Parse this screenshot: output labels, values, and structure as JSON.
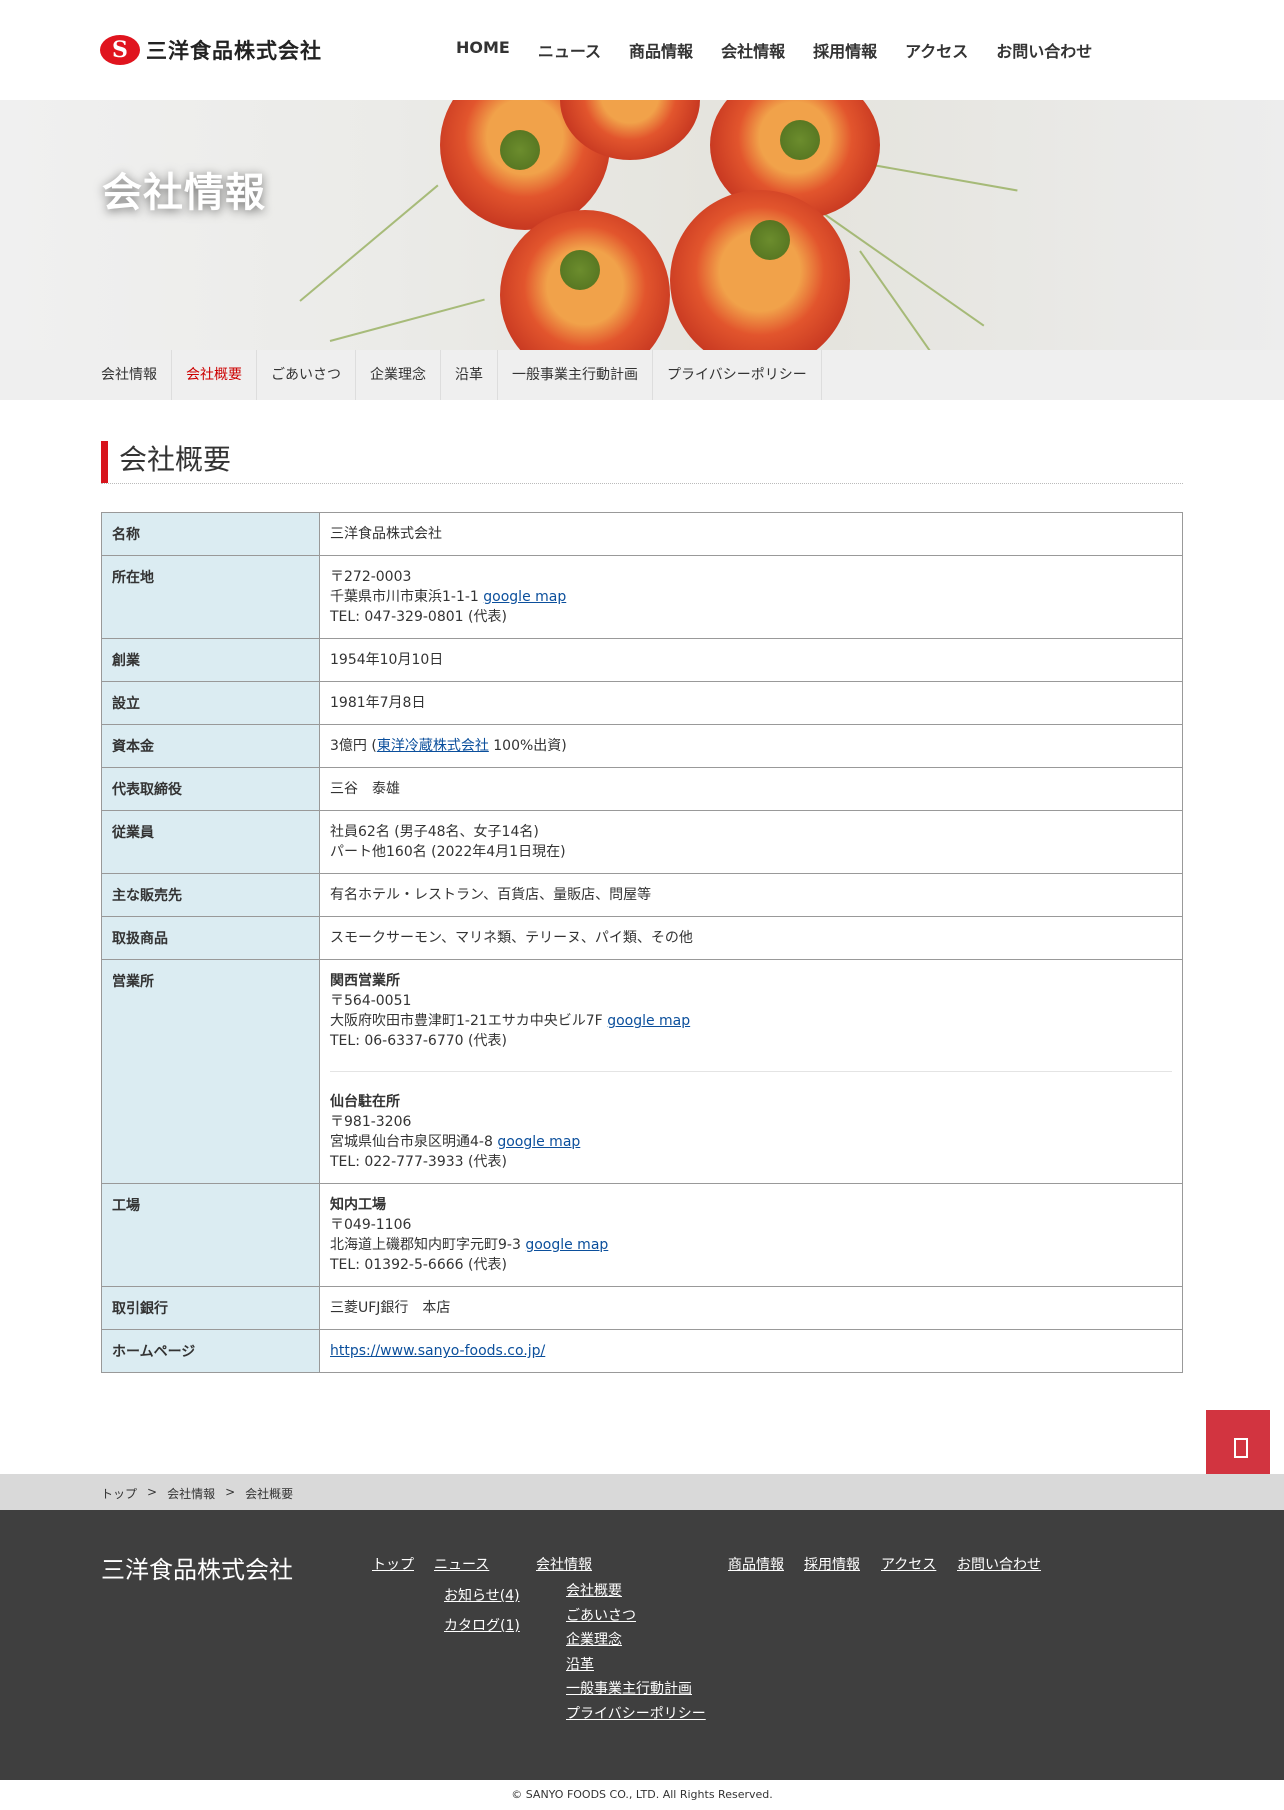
{
  "header": {
    "logo_text": "三洋食品株式会社",
    "nav": [
      "HOME",
      "ニュース",
      "商品情報",
      "会社情報",
      "採用情報",
      "アクセス",
      "お問い合わせ"
    ]
  },
  "hero": {
    "title": "会社情報"
  },
  "subnav": {
    "items": [
      "会社情報",
      "会社概要",
      "ごあいさつ",
      "企業理念",
      "沿革",
      "一般事業主行動計画",
      "プライバシーポリシー"
    ],
    "active_index": 1
  },
  "section": {
    "title": "会社概要"
  },
  "table": {
    "name": {
      "label": "名称",
      "value": "三洋食品株式会社"
    },
    "address": {
      "label": "所在地",
      "postal": "〒272-0003",
      "addr": "千葉県市川市東浜1-1-1 ",
      "map": "google map",
      "tel": "TEL: 047-329-0801 (代表)"
    },
    "founded": {
      "label": "創業",
      "value": "1954年10月10日"
    },
    "established": {
      "label": "設立",
      "value": "1981年7月8日"
    },
    "capital": {
      "label": "資本金",
      "prefix": "3億円 (",
      "link": "東洋冷蔵株式会社",
      "suffix": " 100%出資)"
    },
    "ceo": {
      "label": "代表取締役",
      "value": "三谷　泰雄"
    },
    "employees": {
      "label": "従業員",
      "line1": "社員62名 (男子48名、女子14名)",
      "line2": "パート他160名 (2022年4月1日現在)"
    },
    "customers": {
      "label": "主な販売先",
      "value": "有名ホテル・レストラン、百貨店、量販店、問屋等"
    },
    "products": {
      "label": "取扱商品",
      "value": "スモークサーモン、マリネ類、テリーヌ、パイ類、その他"
    },
    "offices": {
      "label": "営業所",
      "kansai": {
        "name": "関西営業所",
        "postal": "〒564-0051",
        "addr": "大阪府吹田市豊津町1-21エサカ中央ビル7F ",
        "map": "google map",
        "tel": "TEL: 06-6337-6770 (代表)"
      },
      "sendai": {
        "name": "仙台駐在所",
        "postal": "〒981-3206",
        "addr": "宮城県仙台市泉区明通4-8 ",
        "map": "google map",
        "tel": "TEL: 022-777-3933 (代表)"
      }
    },
    "factory": {
      "label": "工場",
      "name": "知内工場",
      "postal": "〒049-1106",
      "addr": "北海道上磯郡知内町字元町9-3 ",
      "map": "google map",
      "tel": "TEL: 01392-5-6666 (代表)"
    },
    "bank": {
      "label": "取引銀行",
      "value": "三菱UFJ銀行　本店"
    },
    "homepage": {
      "label": "ホームページ",
      "value": "https://www.sanyo-foods.co.jp/"
    }
  },
  "breadcrumb": [
    "トップ",
    ">",
    "会社情報",
    ">",
    "会社概要"
  ],
  "footer": {
    "company": "三洋食品株式会社",
    "links": {
      "top": "トップ",
      "news": "ニュース",
      "news_sub": [
        "お知らせ(4)",
        "カタログ(1)"
      ],
      "company": "会社情報",
      "company_sub": [
        "会社概要",
        "ごあいさつ",
        "企業理念",
        "沿革",
        "一般事業主行動計画",
        "プライバシーポリシー"
      ],
      "products": "商品情報",
      "recruit": "採用情報",
      "access": "アクセス",
      "contact": "お問い合わせ"
    },
    "icon": "link-icon"
  },
  "copyright": "© SANYO FOODS CO., LTD. All Rights Reserved.",
  "colors": {
    "accent": "#d7141c",
    "table_th": "#dbecf2",
    "footer_bg": "#3f3f3f",
    "pagetop": "#d23440"
  }
}
